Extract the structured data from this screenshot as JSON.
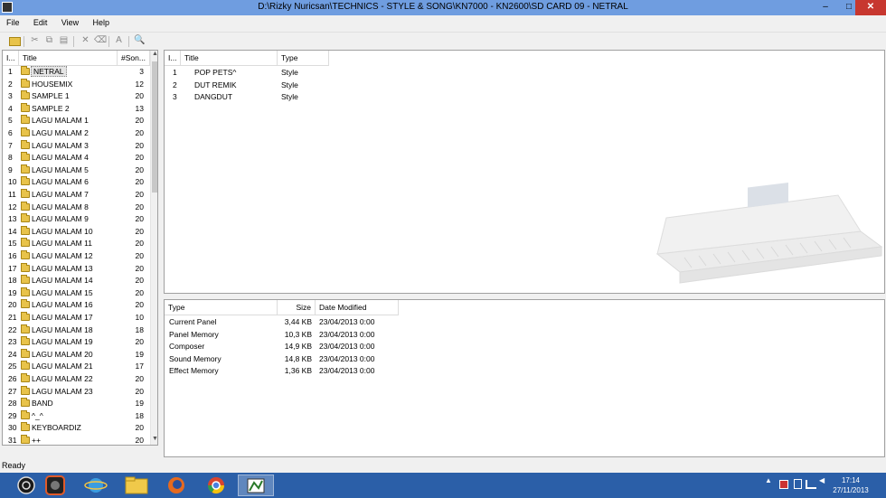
{
  "window": {
    "title": "D:\\Rizky Nuricsan\\TECHNICS - STYLE & SONG\\KN7000 - KN2600\\SD CARD 09 - NETRAL",
    "min_glyph": "–",
    "max_glyph": "□",
    "close_glyph": "✕"
  },
  "menu": [
    "File",
    "Edit",
    "View",
    "Help"
  ],
  "toolbar": {
    "icons": [
      "open-folder-icon",
      "cut-icon",
      "copy-icon",
      "paste-icon",
      "delete-icon",
      "erase-icon",
      "rename-icon",
      "search-icon"
    ],
    "cut_glyph": "✂",
    "copy_glyph": "⧉",
    "paste_glyph": "▤",
    "delete_glyph": "✕",
    "erase_glyph": "⌫",
    "rename_glyph": "A",
    "find_glyph": "🔍"
  },
  "folders": {
    "headers": [
      "I...",
      "Title",
      "#Son..."
    ],
    "rows": [
      {
        "idx": "1",
        "title": "NETRAL",
        "count": "3"
      },
      {
        "idx": "2",
        "title": "HOUSEMIX",
        "count": "12"
      },
      {
        "idx": "3",
        "title": "SAMPLE 1",
        "count": "20"
      },
      {
        "idx": "4",
        "title": "SAMPLE 2",
        "count": "13"
      },
      {
        "idx": "5",
        "title": "LAGU MALAM 1",
        "count": "20"
      },
      {
        "idx": "6",
        "title": "LAGU MALAM 2",
        "count": "20"
      },
      {
        "idx": "7",
        "title": "LAGU MALAM 3",
        "count": "20"
      },
      {
        "idx": "8",
        "title": "LAGU MALAM 4",
        "count": "20"
      },
      {
        "idx": "9",
        "title": "LAGU MALAM 5",
        "count": "20"
      },
      {
        "idx": "10",
        "title": "LAGU MALAM 6",
        "count": "20"
      },
      {
        "idx": "11",
        "title": "LAGU MALAM 7",
        "count": "20"
      },
      {
        "idx": "12",
        "title": "LAGU MALAM 8",
        "count": "20"
      },
      {
        "idx": "13",
        "title": "LAGU MALAM 9",
        "count": "20"
      },
      {
        "idx": "14",
        "title": "LAGU MALAM 10",
        "count": "20"
      },
      {
        "idx": "15",
        "title": "LAGU MALAM 11",
        "count": "20"
      },
      {
        "idx": "16",
        "title": "LAGU MALAM 12",
        "count": "20"
      },
      {
        "idx": "17",
        "title": "LAGU MALAM 13",
        "count": "20"
      },
      {
        "idx": "18",
        "title": "LAGU MALAM 14",
        "count": "20"
      },
      {
        "idx": "19",
        "title": "LAGU MALAM 15",
        "count": "20"
      },
      {
        "idx": "20",
        "title": "LAGU MALAM 16",
        "count": "20"
      },
      {
        "idx": "21",
        "title": "LAGU MALAM 17",
        "count": "10"
      },
      {
        "idx": "22",
        "title": "LAGU MALAM 18",
        "count": "18"
      },
      {
        "idx": "23",
        "title": "LAGU MALAM 19",
        "count": "20"
      },
      {
        "idx": "24",
        "title": "LAGU MALAM 20",
        "count": "19"
      },
      {
        "idx": "25",
        "title": "LAGU MALAM 21",
        "count": "17"
      },
      {
        "idx": "26",
        "title": "LAGU MALAM 22",
        "count": "20"
      },
      {
        "idx": "27",
        "title": "LAGU MALAM 23",
        "count": "20"
      },
      {
        "idx": "28",
        "title": "BAND",
        "count": "19"
      },
      {
        "idx": "29",
        "title": "^_^",
        "count": "18"
      },
      {
        "idx": "30",
        "title": "KEYBOARDIZ",
        "count": "20"
      },
      {
        "idx": "31",
        "title": "++",
        "count": "20"
      }
    ]
  },
  "songs": {
    "headers": [
      "I...",
      "Title",
      "Type"
    ],
    "rows": [
      {
        "idx": "1",
        "title": "POP PETS^",
        "type": "Style"
      },
      {
        "idx": "2",
        "title": "DUT REMIK",
        "type": "Style"
      },
      {
        "idx": "3",
        "title": "DANGDUT",
        "type": "Style"
      }
    ]
  },
  "files": {
    "headers": [
      "Type",
      "Size",
      "Date Modified"
    ],
    "rows": [
      {
        "type": "Current Panel",
        "size": "3,44 KB",
        "date": "23/04/2013 0:00"
      },
      {
        "type": "Panel Memory",
        "size": "10,3 KB",
        "date": "23/04/2013 0:00"
      },
      {
        "type": "Composer",
        "size": "14,9 KB",
        "date": "23/04/2013 0:00"
      },
      {
        "type": "Sound Memory",
        "size": "14,8 KB",
        "date": "23/04/2013 0:00"
      },
      {
        "type": "Effect Memory",
        "size": "1,36 KB",
        "date": "23/04/2013 0:00"
      }
    ]
  },
  "status": "Ready",
  "taskbar": {
    "apps": [
      "start-button",
      "media-app",
      "internet-explorer",
      "file-explorer",
      "firefox",
      "chrome",
      "organizer-app"
    ],
    "active_app": "organizer-app",
    "time": "17:14",
    "date": "27/11/2013"
  },
  "colors": {
    "titlebar": "#6f9de0",
    "taskbar": "#2b5fa8",
    "close": "#c7372f",
    "folder": "#e8c34a"
  }
}
